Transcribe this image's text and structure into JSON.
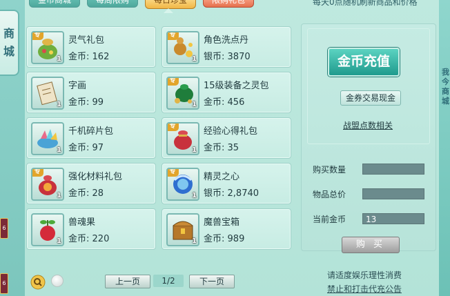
{
  "tabs": [
    {
      "label": "金币商城",
      "active": false
    },
    {
      "label": "每周限购",
      "active": false
    },
    {
      "label": "每日珍宝",
      "active": true
    },
    {
      "label": "限购礼包",
      "active": false
    }
  ],
  "top_note": "每天0点随机刷新商品和价格",
  "side_tab": {
    "chars": [
      "商",
      "城"
    ]
  },
  "left_badges": [
    "6",
    "6"
  ],
  "right_side_chars": [
    "我",
    "今",
    "商",
    "城"
  ],
  "items": [
    {
      "name": "灵气礼包",
      "price_label": "金币:",
      "price": "162",
      "qty": "1",
      "special": true,
      "special_label": "专",
      "icon": "lucky-bag-icon"
    },
    {
      "name": "角色洗点丹",
      "price_label": "银币:",
      "price": "3870",
      "qty": "1",
      "special": true,
      "special_label": "专",
      "icon": "gourd-pill-icon"
    },
    {
      "name": "字画",
      "price_label": "金币:",
      "price": "99",
      "qty": "1",
      "special": false,
      "icon": "scroll-painting-icon"
    },
    {
      "name": "15级装备之灵包",
      "price_label": "金币:",
      "price": "456",
      "qty": "1",
      "special": true,
      "special_label": "专",
      "icon": "green-bag-icon"
    },
    {
      "name": "千机碎片包",
      "price_label": "金币:",
      "price": "97",
      "qty": "1",
      "special": false,
      "icon": "shard-pack-icon"
    },
    {
      "name": "经验心得礼包",
      "price_label": "金币:",
      "price": "35",
      "qty": "1",
      "special": true,
      "special_label": "专",
      "icon": "red-bag-icon"
    },
    {
      "name": "强化材料礼包",
      "price_label": "金币:",
      "price": "28",
      "qty": "1",
      "special": true,
      "special_label": "专",
      "icon": "material-bag-icon"
    },
    {
      "name": "精灵之心",
      "price_label": "银币:",
      "price": "2,8740",
      "qty": "1",
      "special": true,
      "special_label": "专",
      "icon": "spirit-heart-icon"
    },
    {
      "name": "兽魂果",
      "price_label": "金币:",
      "price": "220",
      "qty": "1",
      "special": false,
      "icon": "beast-fruit-icon"
    },
    {
      "name": "魔兽宝箱",
      "price_label": "金币:",
      "price": "989",
      "qty": "1",
      "special": false,
      "icon": "treasure-chest-icon"
    }
  ],
  "right_panel": {
    "recharge_label": "金币充值",
    "exchange_label": "金券交易现金",
    "link_label": "战盟点数相关",
    "quantity_label": "购买数量",
    "quantity_value": "",
    "total_label": "物品总价",
    "total_value": "",
    "gold_label": "当前金币",
    "gold_value": "13",
    "buy_label": "购 买"
  },
  "pager": {
    "prev": "上一页",
    "page": "1/2",
    "next": "下一页"
  },
  "footer": {
    "line1": "请适度娱乐理性消费",
    "line2": "禁止和打击代充公告"
  },
  "colors": {
    "accent": "#1f9a8d",
    "active_tab": "#f1b746",
    "limit_tab": "#e6704e",
    "background": "#b3e3d8"
  }
}
